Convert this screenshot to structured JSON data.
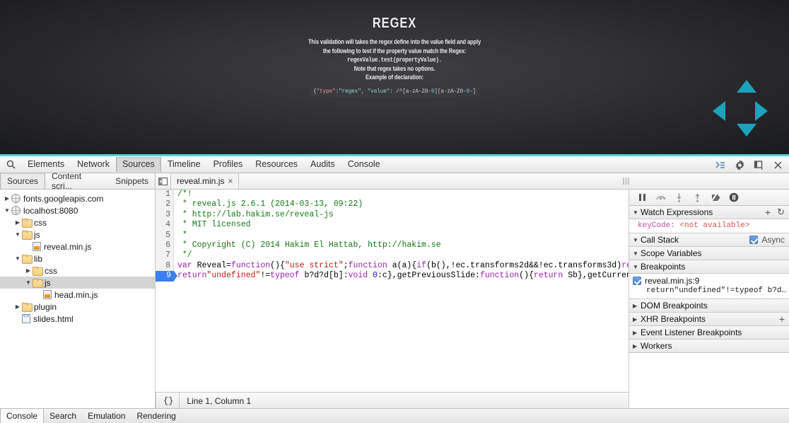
{
  "slide": {
    "title": "REGEX",
    "line1": "This validation will takes the regex define into the value field and apply",
    "line2": "the following to test if the property value match the Regex:",
    "line3_code": "regexValue.test(propertyValue).",
    "line4": "Note that regex takes no options.",
    "line5": "Example of declaration:",
    "code": {
      "open": "{",
      "key1": "\"type\"",
      "colon1": ":",
      "val1": "\"regex\"",
      "comma": ", ",
      "key2": "\"value\"",
      "colon2": ": ",
      "regex_a": "/^[a-zA-Z0-",
      "regex_n1": "9",
      "regex_b": "][a-zA-Z0-",
      "regex_n2": "9",
      "regex_c": "-]"
    },
    "nav": {
      "up": "arrow-up",
      "down": "arrow-down",
      "left": "arrow-left",
      "right": "arrow-right",
      "color": "#1ba3bb"
    }
  },
  "devtools": {
    "panels": [
      "Elements",
      "Network",
      "Sources",
      "Timeline",
      "Profiles",
      "Resources",
      "Audits",
      "Console"
    ],
    "active_panel": "Sources",
    "toolbar_icons": [
      "search-icon",
      "console-drawer-icon",
      "gear-icon",
      "dock-side-icon",
      "close-icon"
    ],
    "sub_tabs": [
      "Sources",
      "Content scri...",
      "Snippets"
    ],
    "active_sub_tab": "Sources",
    "file_tab": {
      "name": "reveal.min.js",
      "close": "×"
    },
    "tree": [
      {
        "indent": 0,
        "twisty": "▶",
        "icon": "globe",
        "label": "fonts.googleapis.com",
        "selected": false
      },
      {
        "indent": 0,
        "twisty": "▼",
        "icon": "globe",
        "label": "localhost:8080",
        "selected": false
      },
      {
        "indent": 1,
        "twisty": "▶",
        "icon": "folder",
        "label": "css",
        "selected": false
      },
      {
        "indent": 1,
        "twisty": "▼",
        "icon": "folder",
        "label": "js",
        "selected": false
      },
      {
        "indent": 2,
        "twisty": "",
        "icon": "js",
        "label": "reveal.min.js",
        "selected": false
      },
      {
        "indent": 1,
        "twisty": "▼",
        "icon": "folder",
        "label": "lib",
        "selected": false
      },
      {
        "indent": 2,
        "twisty": "▶",
        "icon": "folder",
        "label": "css",
        "selected": false
      },
      {
        "indent": 2,
        "twisty": "▼",
        "icon": "folder",
        "label": "js",
        "selected": true
      },
      {
        "indent": 3,
        "twisty": "",
        "icon": "js",
        "label": "head.min.js",
        "selected": false
      },
      {
        "indent": 1,
        "twisty": "▶",
        "icon": "folder",
        "label": "plugin",
        "selected": false
      },
      {
        "indent": 1,
        "twisty": "",
        "icon": "html",
        "label": "slides.html",
        "selected": false
      }
    ],
    "code_lines": [
      {
        "n": "1",
        "active": false,
        "tokens": [
          {
            "c": "com",
            "t": "/*!"
          }
        ]
      },
      {
        "n": "2",
        "active": false,
        "tokens": [
          {
            "c": "com",
            "t": " * reveal.js 2.6.1 (2014-03-13, 09:22)"
          }
        ]
      },
      {
        "n": "3",
        "active": false,
        "tokens": [
          {
            "c": "com",
            "t": " * http://lab.hakim.se/reveal-js"
          }
        ]
      },
      {
        "n": "4",
        "active": false,
        "tokens": [
          {
            "c": "com",
            "t": " * MIT licensed"
          }
        ]
      },
      {
        "n": "5",
        "active": false,
        "tokens": [
          {
            "c": "com",
            "t": " *"
          }
        ]
      },
      {
        "n": "6",
        "active": false,
        "tokens": [
          {
            "c": "com",
            "t": " * Copyright (C) 2014 Hakim El Hattab, http://hakim.se"
          }
        ]
      },
      {
        "n": "7",
        "active": false,
        "tokens": [
          {
            "c": "com",
            "t": " */"
          }
        ]
      },
      {
        "n": "8",
        "active": false,
        "tokens": [
          {
            "c": "kw",
            "t": "var"
          },
          {
            "c": "pln",
            "t": " Reveal="
          },
          {
            "c": "kw",
            "t": "function"
          },
          {
            "c": "pln",
            "t": "(){"
          },
          {
            "c": "str",
            "t": "\"use strict\""
          },
          {
            "c": "pln",
            "t": ";"
          },
          {
            "c": "kw",
            "t": "function"
          },
          {
            "c": "pln",
            "t": " a(a){"
          },
          {
            "c": "kw",
            "t": "if"
          },
          {
            "c": "pln",
            "t": "(b(),!ec.transforms2d&&!ec.transforms3d)"
          },
          {
            "c": "kw",
            "t": "retur"
          }
        ]
      },
      {
        "n": "9",
        "active": true,
        "tokens": [
          {
            "c": "kw",
            "t": "return"
          },
          {
            "c": "str",
            "t": "\"undefined\""
          },
          {
            "c": "pln",
            "t": "!="
          },
          {
            "c": "kw",
            "t": "typeof"
          },
          {
            "c": "pln",
            "t": " b?d?d[b]:"
          },
          {
            "c": "kw",
            "t": "void"
          },
          {
            "c": "pln",
            "t": " "
          },
          {
            "c": "num",
            "t": "0"
          },
          {
            "c": "pln",
            "t": ":c},getPreviousSlide:"
          },
          {
            "c": "kw",
            "t": "function"
          },
          {
            "c": "pln",
            "t": "(){"
          },
          {
            "c": "kw",
            "t": "return"
          },
          {
            "c": "pln",
            "t": " Sb},getCurrentSl"
          }
        ]
      }
    ],
    "editor_status": {
      "brace": "{}",
      "position": "Line 1, Column 1"
    },
    "debug_controls": [
      "pause-icon",
      "step-over-icon",
      "step-into-icon",
      "step-out-icon",
      "deactivate-breakpoints-icon",
      "pause-on-exceptions-icon"
    ],
    "sidebar": {
      "watch": {
        "title": "Watch Expressions",
        "add": "+",
        "refresh": "↻",
        "expr_name": "keyCode:",
        "expr_value": "<not available>"
      },
      "call_stack": {
        "title": "Call Stack",
        "async_label": "Async",
        "async_checked": true
      },
      "scope": {
        "title": "Scope Variables"
      },
      "breakpoints": {
        "title": "Breakpoints",
        "items": [
          {
            "checked": true,
            "location": "reveal.min.js:9",
            "code": "return\"undefined\"!=typeof b?d…"
          }
        ]
      },
      "dom_breakpoints": {
        "title": "DOM Breakpoints"
      },
      "xhr_breakpoints": {
        "title": "XHR Breakpoints",
        "add": "+"
      },
      "event_listener_breakpoints": {
        "title": "Event Listener Breakpoints"
      },
      "workers": {
        "title": "Workers"
      }
    },
    "footer_tabs": [
      "Console",
      "Search",
      "Emulation",
      "Rendering"
    ],
    "active_footer_tab": "Console"
  }
}
